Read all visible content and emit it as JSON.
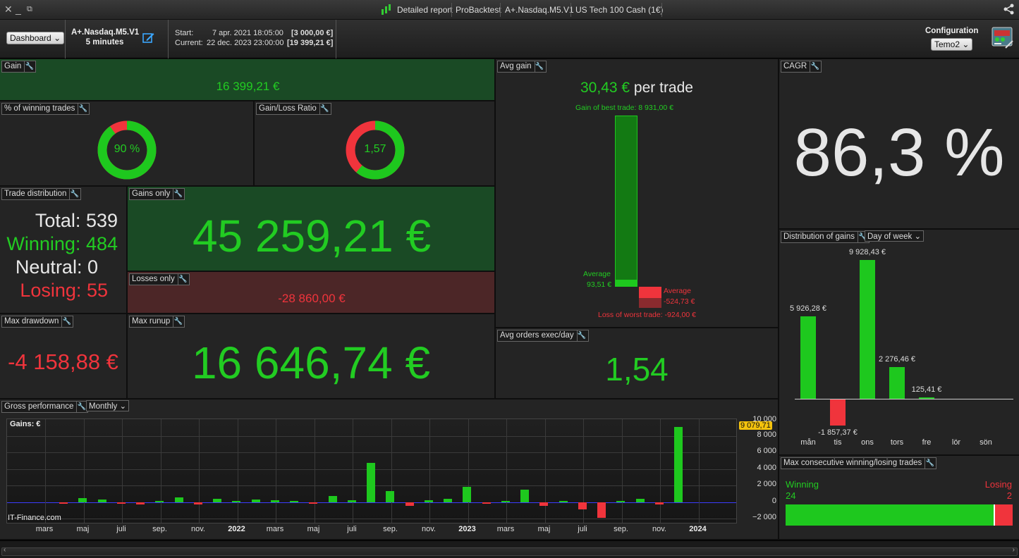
{
  "titlebar": {
    "close_icon": "close-icon",
    "minimize_icon": "minimize-icon",
    "restore_icon": "restore-icon",
    "report_icon": "candlestick-icon",
    "report_label": "Detailed report",
    "tab1": "ProBacktest",
    "tab2": "A+.Nasdaq.M5.V1",
    "tab3": "US Tech 100 Cash (1€)",
    "share_icon": "share-icon"
  },
  "header": {
    "view_select": "Dashboard",
    "system_name": "A+.Nasdaq.M5.V1",
    "timeframe": "5 minutes",
    "edit_icon": "edit-icon",
    "start_label": "Start:",
    "start_date": "7 apr. 2021 18:05:00",
    "start_value": "[3 000,00 €]",
    "current_label": "Current:",
    "current_date": "22 dec. 2023 23:00:00",
    "current_value": "[19 399,21 €]",
    "config_label": "Configuration",
    "config_select": "Temo2",
    "config_icon": "settings-panel-icon"
  },
  "panels": {
    "gain": {
      "title": "Gain",
      "value": "16 399,21 €"
    },
    "winning_pct": {
      "title": "% of winning trades",
      "value": "90 %",
      "fraction": 0.9
    },
    "gain_loss_ratio": {
      "title": "Gain/Loss Ratio",
      "value": "1,57",
      "fraction": 0.611
    },
    "trade_distribution": {
      "title": "Trade distribution",
      "total_label": "Total:",
      "total": "539",
      "winning_label": "Winning:",
      "winning": "484",
      "neutral_label": "Neutral:",
      "neutral": "0",
      "losing_label": "Losing:",
      "losing": "55"
    },
    "gains_only": {
      "title": "Gains only",
      "value": "45 259,21 €"
    },
    "losses_only": {
      "title": "Losses only",
      "value": "-28 860,00 €"
    },
    "max_drawdown": {
      "title": "Max drawdown",
      "value": "-4 158,88 €"
    },
    "max_runup": {
      "title": "Max runup",
      "value": "16 646,74 €"
    },
    "avg_gain": {
      "title": "Avg gain",
      "value": "30,43 €",
      "suffix": "per trade",
      "best_trade": "Gain of best trade: 8 931,00 €",
      "avg_win_label": "Average",
      "avg_win_value": "93,51 €",
      "avg_loss_label": "Average",
      "avg_loss_value": "-524,73 €",
      "worst_trade": "Loss of worst trade: -924,00 €"
    },
    "avg_orders": {
      "title": "Avg orders exec/day",
      "value": "1,54"
    },
    "cagr": {
      "title": "CAGR",
      "value": "86,3 %"
    },
    "distribution_of_gains": {
      "title": "Distribution of gains",
      "select": "Day of week"
    },
    "max_consecutive": {
      "title": "Max consecutive winning/losing trades",
      "winning_label": "Winning",
      "winning_value": "24",
      "losing_label": "Losing",
      "losing_value": "2",
      "winning_count": 24,
      "losing_count": 2
    },
    "gross_performance": {
      "title": "Gross performance",
      "select": "Monthly",
      "gains_label": "Gains: €",
      "watermark": "IT-Finance.com",
      "last_value": "9 079,71",
      "top_tick_partial": "10 000"
    }
  },
  "chart_data": [
    {
      "type": "bar",
      "name": "distribution_of_gains",
      "categories": [
        "mån",
        "tis",
        "ons",
        "tors",
        "fre",
        "lör",
        "sön"
      ],
      "values": [
        5926.28,
        -1857.37,
        9928.43,
        2276.46,
        125.41,
        0,
        0
      ],
      "value_labels": [
        "5 926,28 €",
        "-1 857,37 €",
        "9 928,43 €",
        "2 276,46 €",
        "125,41 €",
        "",
        ""
      ],
      "colors": {
        "positive": "#1ec81e",
        "negative": "#f0343c"
      }
    },
    {
      "type": "bar",
      "name": "gross_performance_monthly",
      "ylim": [
        -2500,
        10000
      ],
      "yticks": [
        -2000,
        0,
        2000,
        4000,
        6000,
        8000
      ],
      "ytick_labels": [
        "−2 000",
        "0",
        "2 000",
        "4 000",
        "6 000",
        "8 000"
      ],
      "xtick_labels": [
        "mars",
        "maj",
        "juli",
        "sep.",
        "nov.",
        "2022",
        "mars",
        "maj",
        "juli",
        "sep.",
        "nov.",
        "2023",
        "mars",
        "maj",
        "juli",
        "sep.",
        "nov.",
        "2024"
      ],
      "xtick_bold": [
        "2022",
        "2023",
        "2024"
      ],
      "values": [
        -60,
        500,
        300,
        -120,
        -300,
        80,
        550,
        -250,
        400,
        150,
        300,
        250,
        150,
        -100,
        750,
        250,
        4700,
        1300,
        -420,
        200,
        420,
        1800,
        -150,
        100,
        1500,
        -450,
        80,
        -900,
        -1900,
        60,
        400,
        -280,
        9079.71
      ],
      "colors": {
        "positive": "#1ec81e",
        "negative": "#f0343c"
      }
    }
  ]
}
